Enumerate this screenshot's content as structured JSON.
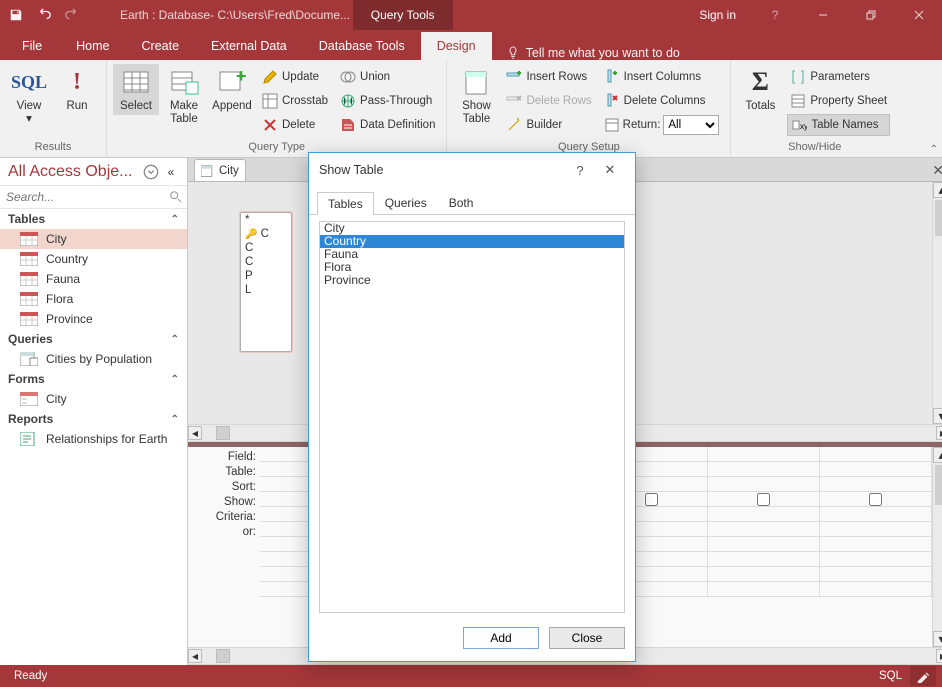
{
  "titlebar": {
    "title": "Earth : Database- C:\\Users\\Fred\\Docume...",
    "contextual": "Query Tools",
    "signin": "Sign in"
  },
  "tabs": {
    "file": "File",
    "home": "Home",
    "create": "Create",
    "externaldata": "External Data",
    "dbtools": "Database Tools",
    "design": "Design",
    "tellme": "Tell me what you want to do"
  },
  "ribbon": {
    "results": {
      "label": "Results",
      "view": "View",
      "run": "Run",
      "sql": "SQL",
      "exclaim": "!"
    },
    "querytype": {
      "label": "Query Type",
      "select": "Select",
      "maketable": "Make\nTable",
      "append": "Append",
      "update": "Update",
      "crosstab": "Crosstab",
      "delete": "Delete",
      "union": "Union",
      "passthrough": "Pass-Through",
      "datadef": "Data Definition"
    },
    "querysetup": {
      "label": "Query Setup",
      "showtable": "Show\nTable",
      "insertrows": "Insert Rows",
      "deleterows": "Delete Rows",
      "builder": "Builder",
      "insertcols": "Insert Columns",
      "deletecols": "Delete Columns",
      "return": "Return:",
      "returnval": "All"
    },
    "totals": {
      "label": "Totals"
    },
    "showhide": {
      "label": "Show/Hide",
      "parameters": "Parameters",
      "propertysheet": "Property Sheet",
      "tablenames": "Table Names"
    }
  },
  "nav": {
    "header": "All Access Obje...",
    "search": "Search...",
    "cats": {
      "tables": "Tables",
      "queries": "Queries",
      "forms": "Forms",
      "reports": "Reports"
    },
    "tables": [
      "City",
      "Country",
      "Fauna",
      "Flora",
      "Province"
    ],
    "queries": [
      "Cities by Population"
    ],
    "forms": [
      "City"
    ],
    "reports": [
      "Relationships for Earth"
    ]
  },
  "doc": {
    "tab": "City",
    "tablecard": [
      "*",
      "C",
      "C",
      "C",
      "P",
      "L"
    ],
    "gridlabels": [
      "Field:",
      "Table:",
      "Sort:",
      "Show:",
      "Criteria:",
      "or:"
    ]
  },
  "dialog": {
    "title": "Show Table",
    "tabs": {
      "tables": "Tables",
      "queries": "Queries",
      "both": "Both"
    },
    "items": [
      "City",
      "Country",
      "Fauna",
      "Flora",
      "Province"
    ],
    "selected": "Country",
    "add": "Add",
    "close": "Close"
  },
  "status": {
    "ready": "Ready",
    "sql": "SQL"
  }
}
